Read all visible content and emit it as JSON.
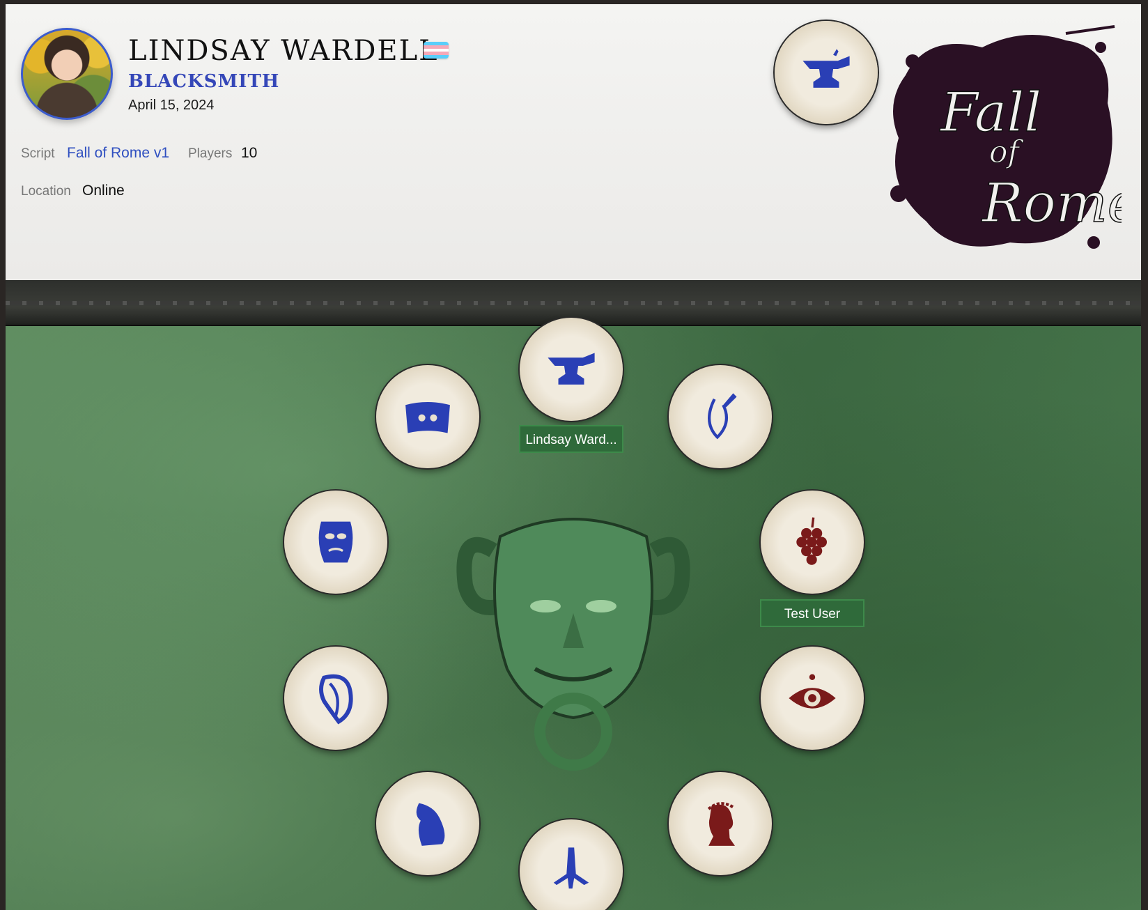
{
  "profile": {
    "name": "LINDSAY WARDELL",
    "role": "BLACKSMITH",
    "date": "April 15, 2024",
    "script_label": "Script",
    "script_value": "Fall of Rome v1",
    "players_label": "Players",
    "players_value": "10",
    "location_label": "Location",
    "location_value": "Online",
    "flag": "transgender-flag",
    "avatar": "user-photo"
  },
  "logo": {
    "text": "Fall of Rome"
  },
  "grimoire": {
    "tokens": [
      {
        "icon": "anvil-icon",
        "team": "good",
        "player": "Lindsay Ward..."
      },
      {
        "icon": "horn-icon",
        "team": "good",
        "player": ""
      },
      {
        "icon": "grapes-icon",
        "team": "evil",
        "player": "Test User"
      },
      {
        "icon": "eye-icon",
        "team": "evil",
        "player": ""
      },
      {
        "icon": "laurel-head-icon",
        "team": "evil",
        "player": ""
      },
      {
        "icon": "eagle-claw-icon",
        "team": "good",
        "player": ""
      },
      {
        "icon": "toga-icon",
        "team": "good",
        "player": ""
      },
      {
        "icon": "veiled-head-icon",
        "team": "good",
        "player": ""
      },
      {
        "icon": "mask-icon",
        "team": "good",
        "player": ""
      },
      {
        "icon": "scroll-icon",
        "team": "good",
        "player": ""
      }
    ]
  },
  "colors": {
    "good": "#2a3fb5",
    "evil": "#7a1a1a",
    "accent": "#3547b8",
    "label_bg": "#2f6a3a"
  }
}
